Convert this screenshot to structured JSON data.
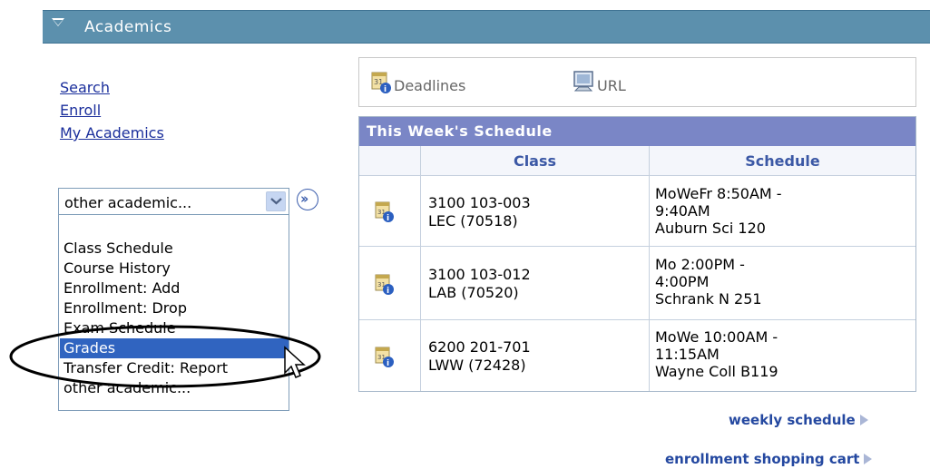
{
  "header": {
    "title": "Academics"
  },
  "links": [
    "Search",
    "Enroll",
    "My Academics"
  ],
  "dropdown": {
    "selected": "other academic...",
    "options": [
      "Class Schedule",
      "Course History",
      "Enrollment: Add",
      "Enrollment: Drop",
      "Exam Schedule",
      "Grades",
      "Transfer Credit: Report",
      "other academic..."
    ],
    "highlighted": "Grades"
  },
  "toolbar": {
    "deadlines": "Deadlines",
    "url": "URL"
  },
  "schedule": {
    "title": "This Week's Schedule",
    "headers": {
      "class": "Class",
      "schedule": "Schedule"
    },
    "rows": [
      {
        "class1": "3100 103-003",
        "class2": "LEC (70518)",
        "s1": "MoWeFr 8:50AM -",
        "s2": "9:40AM",
        "s3": "Auburn Sci 120"
      },
      {
        "class1": "3100 103-012",
        "class2": "LAB (70520)",
        "s1": "Mo 2:00PM -",
        "s2": "4:00PM",
        "s3": "Schrank N 251"
      },
      {
        "class1": "6200 201-701",
        "class2": "LWW (72428)",
        "s1": "MoWe 10:00AM -",
        "s2": "11:15AM",
        "s3": "Wayne Coll B119"
      }
    ]
  },
  "footer_links": {
    "weekly": "weekly schedule",
    "cart": "enrollment shopping cart"
  },
  "colors": {
    "header": "#5c90ad",
    "caption": "#7a86c6",
    "selection": "#3064c0",
    "link": "#1b2f9c"
  }
}
